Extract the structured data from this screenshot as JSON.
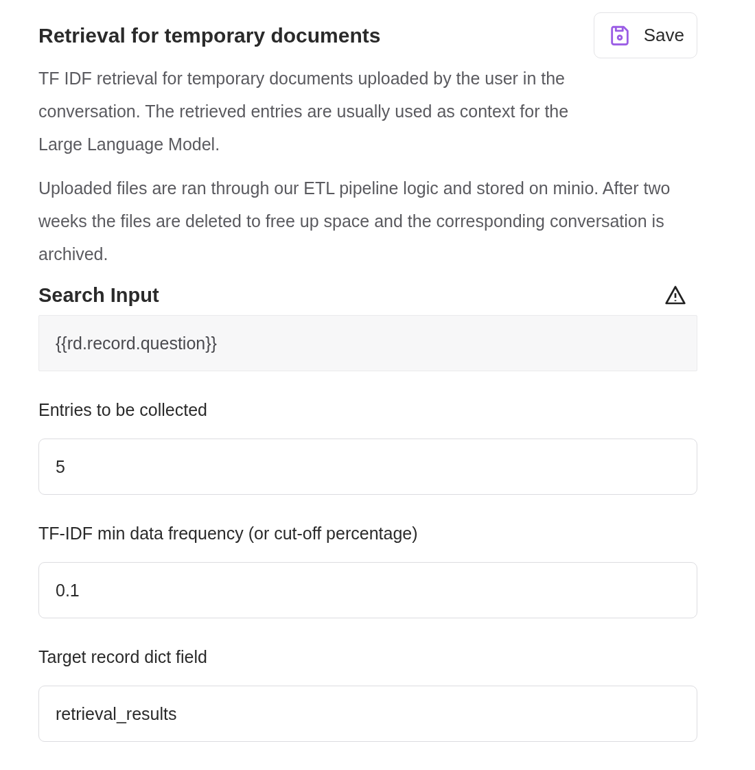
{
  "header": {
    "title": "Retrieval for temporary documents",
    "save_button": "Save"
  },
  "description": [
    "TF IDF retrieval for temporary documents uploaded by the user in the conversation. The retrieved entries are usually used as context for the Large Language Model.",
    "Uploaded files are ran through our ETL pipeline logic and stored on minio. After two weeks the files are deleted to free up space and the corresponding conversation is archived."
  ],
  "search_input": {
    "label": "Search Input",
    "value": "{{rd.record.question}}",
    "disabled": true,
    "warning": true
  },
  "fields": [
    {
      "label": "Entries to be collected",
      "value": "5",
      "disabled": false
    },
    {
      "label": "TF-IDF min data frequency (or cut-off percentage)",
      "value": "0.1",
      "disabled": false
    },
    {
      "label": "Target record dict field",
      "value": "retrieval_results",
      "disabled": false
    }
  ]
}
